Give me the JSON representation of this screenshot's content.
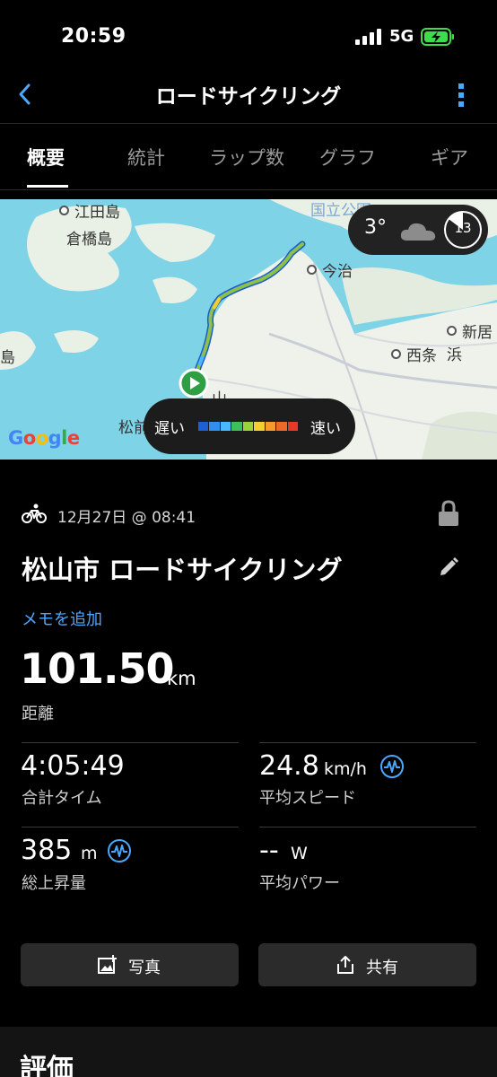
{
  "status_bar": {
    "time": "20:59",
    "network": "5G"
  },
  "nav": {
    "title": "ロードサイクリング"
  },
  "tabs": [
    {
      "label": "概要",
      "active": true
    },
    {
      "label": "統計",
      "active": false
    },
    {
      "label": "ラップ数",
      "active": false
    },
    {
      "label": "グラフ",
      "active": false
    },
    {
      "label": "ギア",
      "active": false
    }
  ],
  "map": {
    "labels": {
      "etajima": "江田島",
      "kurahashijima": "倉橋島",
      "national_park": "国立公園",
      "imabari": "今治",
      "niihama": "新居浜",
      "saijo": "西条",
      "island": "島",
      "matsuyama": "松前",
      "yama": "山"
    },
    "weather": {
      "temperature": "3°",
      "condition": "cloud-icon",
      "moon_value": "13"
    },
    "speed_legend": {
      "slow": "遅い",
      "fast": "速い",
      "colors": [
        "#1e5fd6",
        "#2f8ff0",
        "#4ab8ff",
        "#3fbf5a",
        "#9ad23a",
        "#f2cf2e",
        "#f59a2b",
        "#ef6a2a",
        "#e53a2a"
      ]
    },
    "logo": "Google"
  },
  "activity": {
    "date": "12月27日 @ 08:41",
    "title": "松山市 ロードサイクリング",
    "add_memo": "メモを追加",
    "distance": {
      "value": "101.50",
      "unit": "km",
      "label": "距離"
    },
    "stats": {
      "total_time": {
        "value": "4:05:49",
        "unit": "",
        "label": "合計タイム"
      },
      "avg_speed": {
        "value": "24.8",
        "unit": "km/h",
        "label": "平均スピード"
      },
      "elevation_gain": {
        "value": "385",
        "unit": "m",
        "label": "総上昇量"
      },
      "avg_power": {
        "value": "--",
        "unit": "W",
        "label": "平均パワー"
      }
    }
  },
  "actions": {
    "photo": "写真",
    "share": "共有"
  },
  "rating": {
    "title": "評価"
  },
  "colors": {
    "accent": "#4aa8ff",
    "battery": "#3ddc4a",
    "route": "#8bc34a"
  }
}
